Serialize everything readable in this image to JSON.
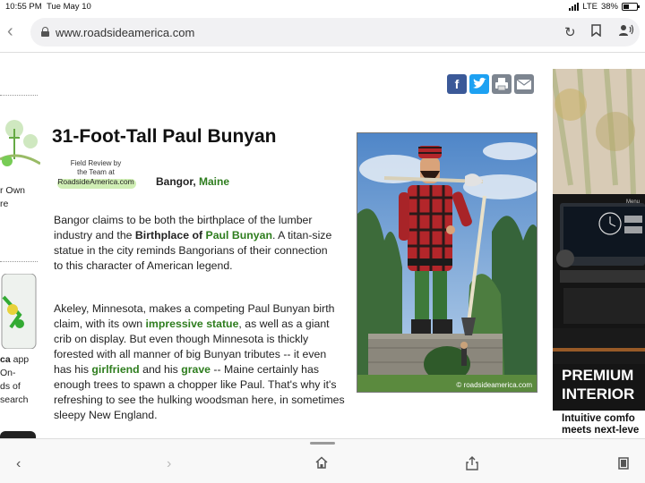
{
  "status_bar": {
    "time": "10:55 PM",
    "date": "Tue May 10",
    "network": "LTE",
    "battery": "38%"
  },
  "browser": {
    "url": "www.roadsideamerica.com",
    "icons": [
      "chevron-left-icon",
      "lock-icon",
      "reload-icon",
      "bookmark-icon",
      "reader-icon"
    ]
  },
  "left_column": {
    "snippet_1": [
      "r Own",
      "re"
    ],
    "snippet_2": [
      "ca app",
      "On-",
      "ds of",
      "search"
    ],
    "snippet_2_bold": "ca"
  },
  "share_icons": [
    "facebook-icon",
    "twitter-icon",
    "print-icon",
    "email-icon"
  ],
  "article": {
    "title": "31-Foot-Tall Paul Bunyan",
    "badge_line1": "Field Review by",
    "badge_line2": "the Team at",
    "badge_line3": "RoadsideAmerica.com",
    "city": "Bangor, ",
    "state": "Maine",
    "p1": {
      "a": "Bangor claims to be both the birthplace of the lumber industry and the ",
      "b": "Birthplace of ",
      "c": "Paul Bunyan",
      "d": ". A titan-size statue in the city reminds Bangorians of their connection to this character of American legend."
    },
    "p2": {
      "a": "Akeley, Minnesota, makes a competing Paul Bunyan birth claim, with its own ",
      "b": "impressive statue",
      "c": ", as well as a giant crib on display. But even though Minnesota is thickly forested with all manner of big Bunyan tributes -- it even has his ",
      "d": "girlfriend",
      "e": " and his ",
      "f": "grave",
      "g": " -- Maine certainly has enough trees to spawn a chopper like Paul. That's why it's refreshing to see the hulking woodsman here, in sometimes sleepy New England."
    },
    "photo_credit": "© roadsideamerica.com"
  },
  "ad": {
    "title_l1": "PREMIUM",
    "title_l2": "INTERIOR",
    "sub_l1": "Intuitive comfo",
    "sub_l2": "meets next-leve",
    "screen_label": "Menu"
  },
  "bottom_bar": {
    "icons": [
      "back-icon",
      "forward-icon",
      "home-icon",
      "share-icon",
      "tabs-icon"
    ]
  },
  "colors": {
    "link_green": "#2e7d1e",
    "facebook": "#3b5998",
    "twitter": "#1da1f2"
  }
}
